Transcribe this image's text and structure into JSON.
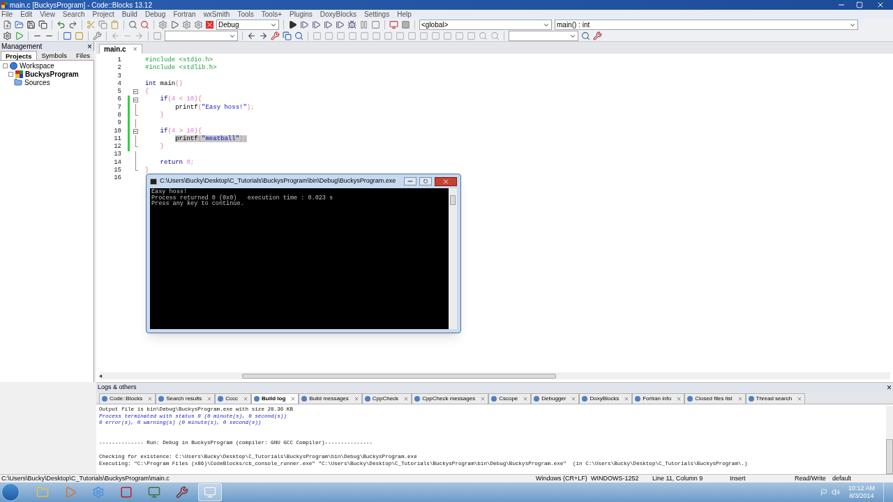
{
  "window": {
    "title": "main.c [BuckysProgram] - Code::Blocks 13.12"
  },
  "menu": [
    "File",
    "Edit",
    "View",
    "Search",
    "Project",
    "Build",
    "Debug",
    "Fortran",
    "wxSmith",
    "Tools",
    "Tools+",
    "Plugins",
    "DoxyBlocks",
    "Settings",
    "Help"
  ],
  "toolbar": {
    "build_target": "Debug",
    "scope": "<global>",
    "function": "main() : int"
  },
  "management": {
    "title": "Management",
    "close": "×",
    "tabs": [
      {
        "label": "Projects",
        "selected": true
      },
      {
        "label": "Symbols",
        "selected": false
      },
      {
        "label": "Files",
        "selected": false
      }
    ],
    "tree": [
      {
        "label": "Workspace",
        "kind": "workspace",
        "active": false,
        "children": [
          {
            "label": "BuckysProgram",
            "kind": "project",
            "active": true,
            "children": [
              {
                "label": "Sources",
                "kind": "folder",
                "active": false
              }
            ]
          }
        ]
      }
    ]
  },
  "editor": {
    "tabs": [
      {
        "label": "main.c",
        "close": "×",
        "selected": true
      }
    ],
    "lines": [
      {
        "number": "1",
        "changed": false,
        "kind": "plain",
        "highlighted": false,
        "tokens": [
          {
            "kind": "preprocessor",
            "text": "#include <stdio.h>"
          }
        ]
      },
      {
        "number": "2",
        "changed": false,
        "kind": "plain",
        "highlighted": false,
        "tokens": [
          {
            "kind": "preprocessor",
            "text": "#include <stdlib.h>"
          }
        ]
      },
      {
        "number": "3",
        "changed": false,
        "kind": "plain",
        "highlighted": false
      },
      {
        "number": "4",
        "changed": false,
        "kind": "plain",
        "highlighted": false,
        "tokens": [
          {
            "kind": "keyword",
            "text": "int"
          },
          {
            "kind": "plain",
            "text": " main"
          },
          {
            "kind": "operator",
            "text": "()"
          }
        ]
      },
      {
        "number": "5",
        "changed": false,
        "kind": "foldstart",
        "highlighted": false,
        "tokens": [
          {
            "kind": "operator",
            "text": "{"
          }
        ]
      },
      {
        "number": "6",
        "changed": true,
        "kind": "foldstart",
        "highlighted": false,
        "tokens": [
          {
            "kind": "keyword",
            "text": "    if"
          },
          {
            "kind": "operator",
            "text": "("
          },
          {
            "kind": "number",
            "text": "4"
          },
          {
            "kind": "operator",
            "text": " < "
          },
          {
            "kind": "number",
            "text": "10"
          },
          {
            "kind": "operator",
            "text": "){"
          }
        ]
      },
      {
        "number": "7",
        "changed": true,
        "kind": "foldbody",
        "highlighted": false,
        "tokens": [
          {
            "kind": "plain",
            "text": "        printf"
          },
          {
            "kind": "operator",
            "text": "("
          },
          {
            "kind": "string",
            "text": "\"Easy hoss!\""
          },
          {
            "kind": "operator",
            "text": ");"
          }
        ]
      },
      {
        "number": "8",
        "changed": true,
        "kind": "foldend",
        "highlighted": false,
        "tokens": [
          {
            "kind": "operator",
            "text": "    }"
          }
        ]
      },
      {
        "number": "9",
        "changed": true,
        "kind": "foldbody",
        "highlighted": false
      },
      {
        "number": "10",
        "changed": true,
        "kind": "foldstart",
        "highlighted": false,
        "tokens": [
          {
            "kind": "keyword",
            "text": "    if"
          },
          {
            "kind": "operator",
            "text": "("
          },
          {
            "kind": "number",
            "text": "4"
          },
          {
            "kind": "operator",
            "text": " > "
          },
          {
            "kind": "number",
            "text": "10"
          },
          {
            "kind": "operator",
            "text": "){"
          }
        ]
      },
      {
        "number": "11",
        "changed": true,
        "kind": "foldbody",
        "highlighted": true,
        "tokens": [
          {
            "kind": "plain",
            "text": "        printf"
          },
          {
            "kind": "operator",
            "text": "("
          },
          {
            "kind": "string",
            "text": "\"meatball\""
          },
          {
            "kind": "operator",
            "text": ");"
          }
        ]
      },
      {
        "number": "12",
        "changed": true,
        "kind": "foldend",
        "highlighted": false,
        "tokens": [
          {
            "kind": "operator",
            "text": "    }"
          }
        ]
      },
      {
        "number": "13",
        "changed": false,
        "kind": "foldbody",
        "highlighted": false
      },
      {
        "number": "14",
        "changed": false,
        "kind": "foldbody",
        "highlighted": false,
        "tokens": [
          {
            "kind": "keyword",
            "text": "    return"
          },
          {
            "kind": "number",
            "text": " 0"
          },
          {
            "kind": "operator",
            "text": ";"
          }
        ]
      },
      {
        "number": "15",
        "changed": false,
        "kind": "foldend",
        "highlighted": false,
        "tokens": [
          {
            "kind": "operator",
            "text": "}"
          }
        ]
      },
      {
        "number": "16",
        "changed": false,
        "kind": "plain",
        "highlighted": false
      }
    ]
  },
  "console": {
    "title": "C:\\Users\\Bucky\\Desktop\\C_Tutorials\\BuckysProgram\\bin\\Debug\\BuckysProgram.exe",
    "lines": [
      "Easy hoss!",
      "Process returned 0 (0x0)   execution time : 0.023 s",
      "Press any key to continue."
    ]
  },
  "logs": {
    "title": "Logs & others",
    "close": "×",
    "tabs": [
      {
        "label": "Code::Blocks",
        "selected": false
      },
      {
        "label": "Search results",
        "selected": false
      },
      {
        "label": "Cccc",
        "selected": false
      },
      {
        "label": "Build log",
        "selected": true
      },
      {
        "label": "Build messages",
        "selected": false
      },
      {
        "label": "CppCheck",
        "selected": false
      },
      {
        "label": "CppCheck messages",
        "selected": false
      },
      {
        "label": "Cscope",
        "selected": false
      },
      {
        "label": "Debugger",
        "selected": false
      },
      {
        "label": "DoxyBlocks",
        "selected": false
      },
      {
        "label": "Fortran info",
        "selected": false
      },
      {
        "label": "Closed files list",
        "selected": false
      },
      {
        "label": "Thread search",
        "selected": false
      }
    ],
    "lines": [
      {
        "kind": "normal",
        "text": "Output file is bin\\Debug\\BuckysProgram.exe with size 28.36 KB"
      },
      {
        "kind": "info",
        "text": "Process terminated with status 0 (0 minute(s), 0 second(s))"
      },
      {
        "kind": "info",
        "text": "0 error(s), 0 warning(s) (0 minute(s), 0 second(s))"
      },
      {
        "kind": "blank"
      },
      {
        "kind": "blank"
      },
      {
        "kind": "normal",
        "text": "-------------- Run: Debug in BuckysProgram (compiler: GNU GCC Compiler)---------------"
      },
      {
        "kind": "blank"
      },
      {
        "kind": "normal",
        "text": "Checking for existence: C:\\Users\\Bucky\\Desktop\\C_Tutorials\\BuckysProgram\\bin\\Debug\\BuckysProgram.exe"
      },
      {
        "kind": "normal",
        "text": "Executing: \"C:\\Program Files (x86)\\CodeBlocks/cb_console_runner.exe\" \"C:\\Users\\Bucky\\Desktop\\C_Tutorials\\BuckysProgram\\bin\\Debug\\BuckysProgram.exe\"  (in C:\\Users\\Bucky\\Desktop\\C_Tutorials\\BuckysProgram\\.)"
      }
    ]
  },
  "status_bar": {
    "path": "C:\\Users\\Bucky\\Desktop\\C_Tutorials\\BuckysProgram\\main.c",
    "line_endings": "Windows (CR+LF)",
    "encoding": "WINDOWS-1252",
    "position": "Line 11, Column 9",
    "mode": "Insert",
    "access": "Read/Write",
    "profile": "default"
  },
  "taskbar": {
    "time": "10:12 AM",
    "date": "8/3/2014"
  }
}
